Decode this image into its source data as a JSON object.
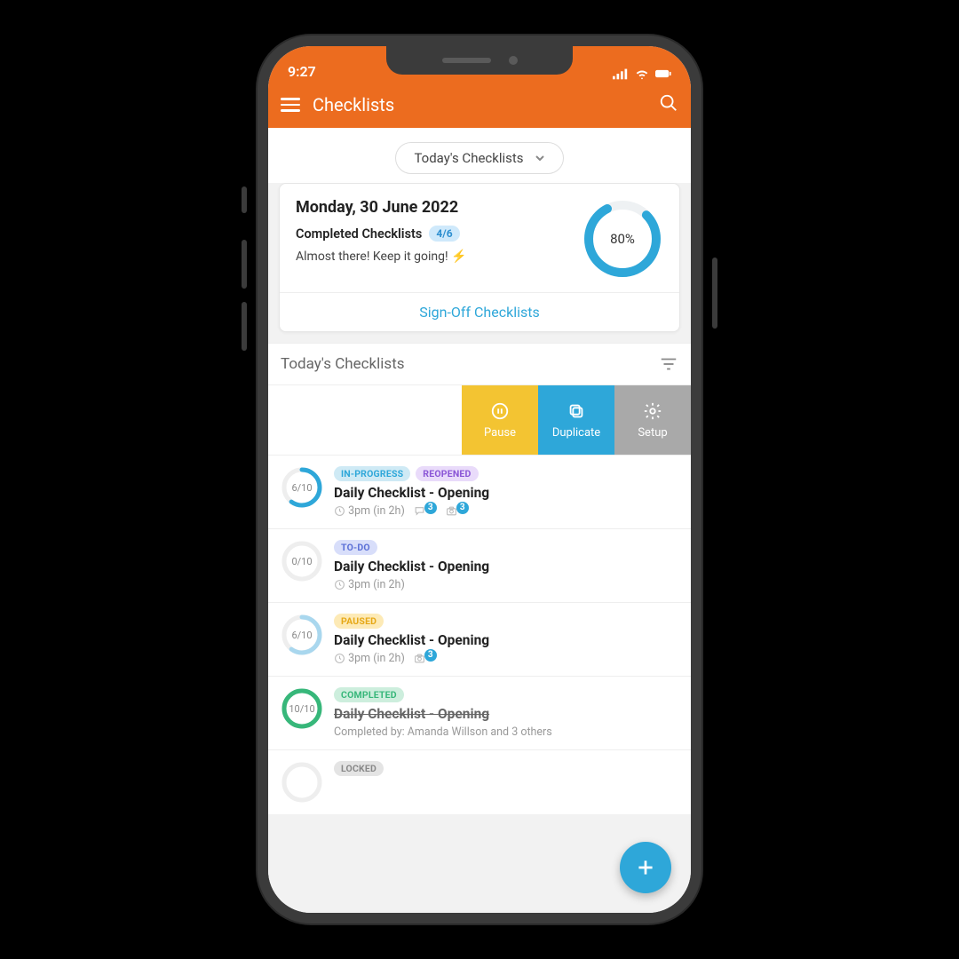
{
  "status": {
    "time": "9:27"
  },
  "header": {
    "title": "Checklists"
  },
  "dropdown": {
    "label": "Today's Checklists"
  },
  "summary": {
    "date": "Monday, 30 June 2022",
    "completed_label": "Completed Checklists",
    "completed_badge": "4/6",
    "message": "Almost there! Keep it going! ⚡",
    "percent_label": "80%",
    "percent_value": 80,
    "signoff": "Sign-Off Checklists"
  },
  "section": {
    "title": "Today's Checklists"
  },
  "actions": {
    "pause": "Pause",
    "duplicate": "Duplicate",
    "setup": "Setup"
  },
  "items": [
    {
      "progress": "6/10",
      "pct": 60,
      "ring_color": "#2ea7d9",
      "pills": [
        {
          "cls": "p-inprog",
          "t": "IN-PROGRESS"
        },
        {
          "cls": "p-reopened",
          "t": "REOPENED"
        }
      ],
      "title": "Daily Checklist - Opening",
      "strike": false,
      "time": "3pm (in 2h)",
      "comments": 3,
      "photos": 3,
      "sub": ""
    },
    {
      "progress": "0/10",
      "pct": 0,
      "ring_color": "#e7e7e7",
      "pills": [
        {
          "cls": "p-todo",
          "t": "TO-DO"
        }
      ],
      "title": "Daily Checklist - Opening",
      "strike": false,
      "time": "3pm (in 2h)",
      "comments": 0,
      "photos": 0,
      "sub": ""
    },
    {
      "progress": "6/10",
      "pct": 60,
      "ring_color": "#a9d7ee",
      "pills": [
        {
          "cls": "p-paused",
          "t": "PAUSED"
        }
      ],
      "title": "Daily Checklist - Opening",
      "strike": false,
      "time": "3pm (in 2h)",
      "comments": 0,
      "photos": 3,
      "sub": ""
    },
    {
      "progress": "10/10",
      "pct": 100,
      "ring_color": "#37b77a",
      "pills": [
        {
          "cls": "p-completed",
          "t": "COMPLETED"
        }
      ],
      "title": "Daily Checklist - Opening",
      "strike": true,
      "time": "",
      "comments": 0,
      "photos": 0,
      "sub": "Completed by: Amanda Willson and 3 others"
    },
    {
      "progress": "",
      "pct": 0,
      "ring_color": "#e7e7e7",
      "pills": [
        {
          "cls": "p-locked",
          "t": "LOCKED"
        }
      ],
      "title": "",
      "strike": false,
      "time": "",
      "comments": 0,
      "photos": 0,
      "sub": ""
    }
  ]
}
